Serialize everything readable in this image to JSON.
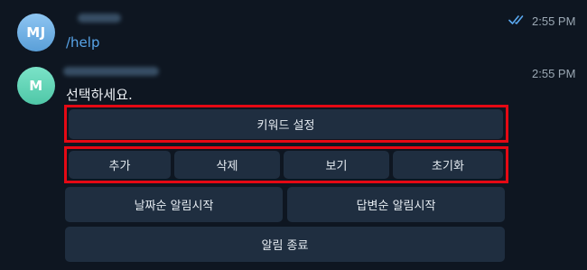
{
  "messages": [
    {
      "avatar_initials": "MJ",
      "text": "/help",
      "time": "2:55 PM",
      "status_icon": "double-check-icon"
    },
    {
      "avatar_initials": "M",
      "text": "선택하세요.",
      "time": "2:55 PM"
    }
  ],
  "keyboard": {
    "row1": [
      "키워드 설정"
    ],
    "row2": [
      "추가",
      "삭제",
      "보기",
      "초기화"
    ],
    "row3": [
      "날짜순 알림시작",
      "답변순 알림시작"
    ],
    "row4": [
      "알림 종료"
    ]
  },
  "colors": {
    "background": "#0e1621",
    "button": "#1f2e40",
    "link": "#58a4e8",
    "highlight": "#e50914",
    "check": "#5aa8f0"
  }
}
